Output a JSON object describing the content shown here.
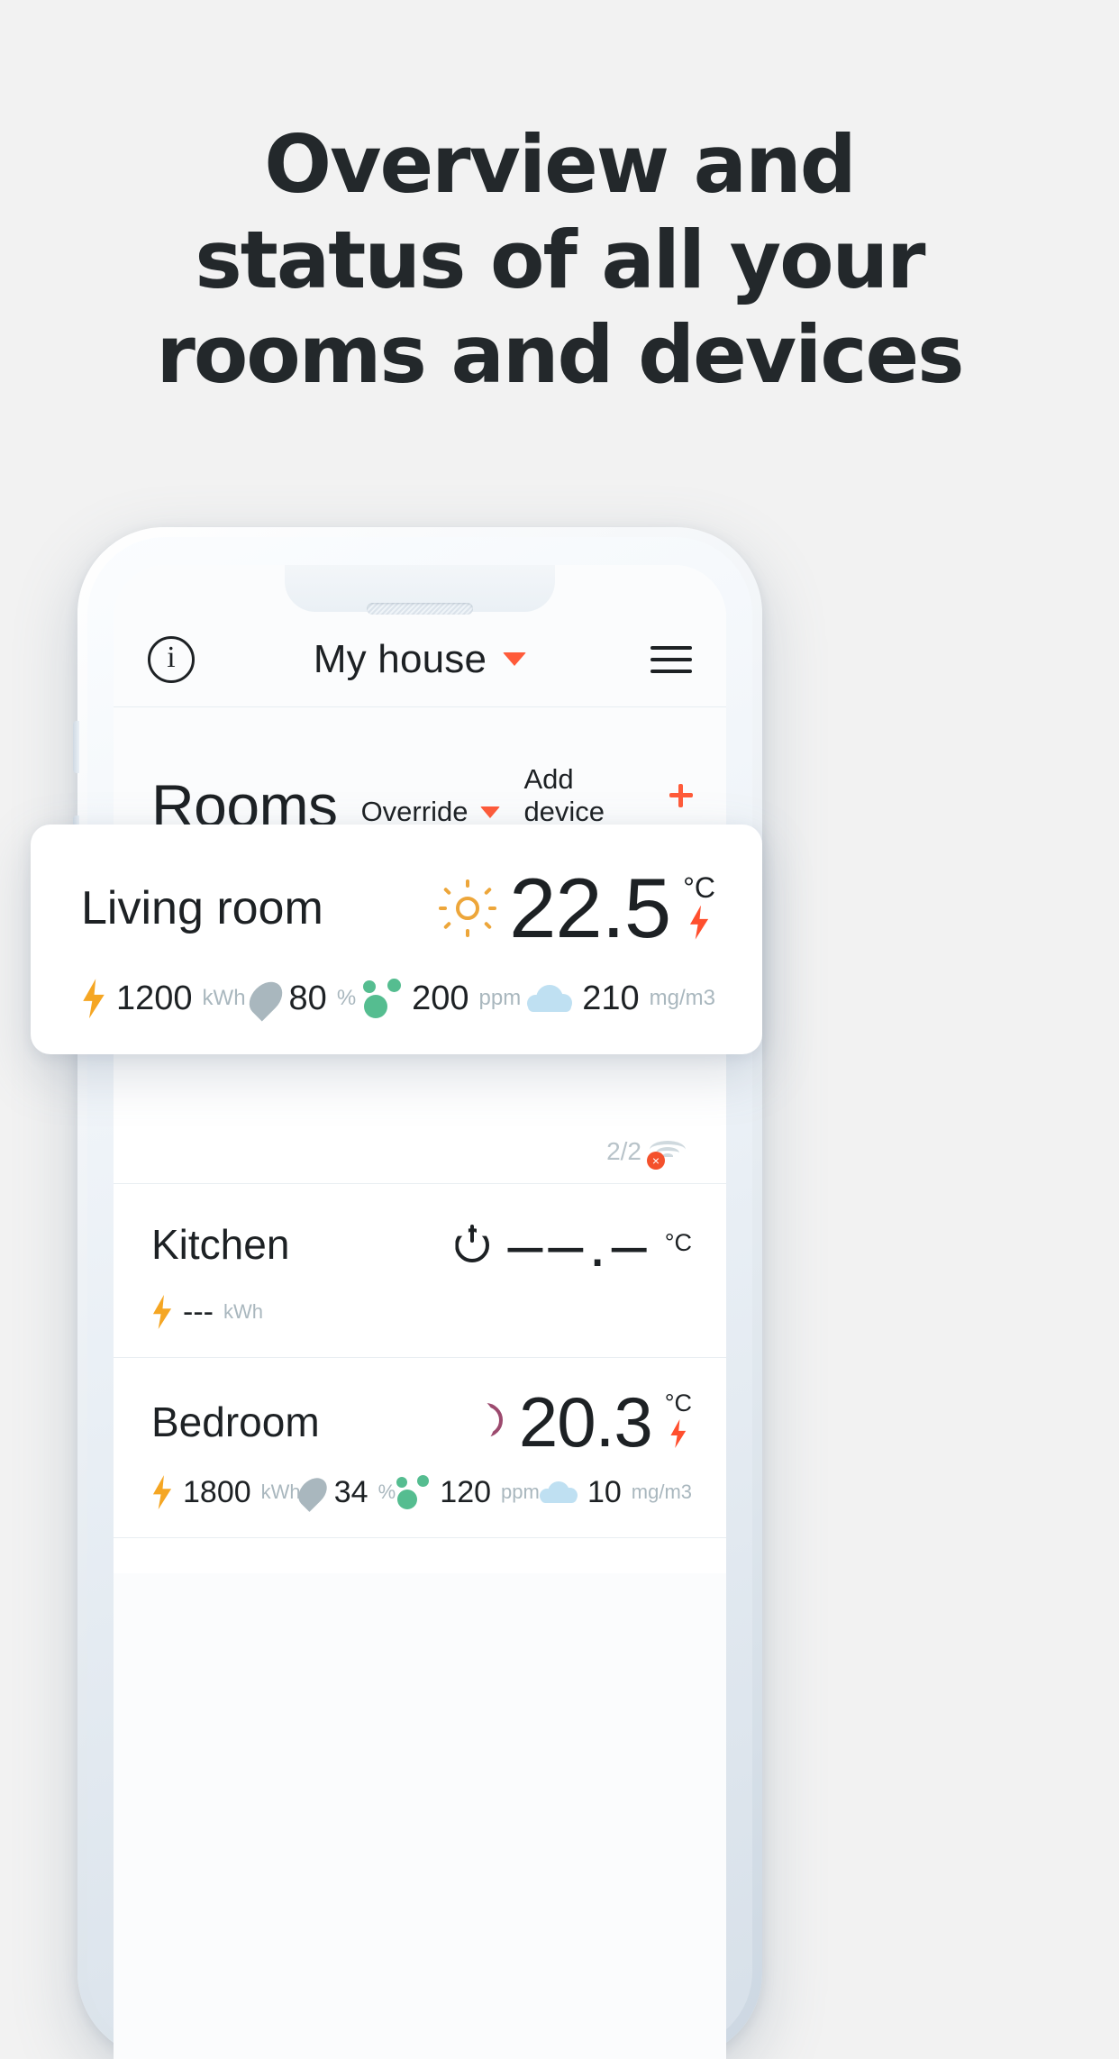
{
  "headline": {
    "line1": "Overview and",
    "line2": "status of all your",
    "line3": "rooms and devices"
  },
  "app": {
    "navbar": {
      "info_icon": "info-icon",
      "title": "My house",
      "chevron_icon": "chevron-down-icon",
      "menu_icon": "hamburger-menu-icon"
    },
    "section": {
      "title": "Rooms",
      "override_label": "Override",
      "override_chevron": "chevron-down-icon",
      "add_device_label": "Add device",
      "add_device_icon": "plus-icon"
    },
    "colors": {
      "accent": "#ff5b3a",
      "energy": "#f5a623",
      "humidity": "#a9b7be",
      "co2": "#55bd90",
      "voc": "#bfe0f2",
      "sun": "#eda63a",
      "moon": "#9c4a6e",
      "text": "#1d2124",
      "muted": "#a9b7be"
    },
    "rooms": [
      {
        "name": "Living room",
        "mode_icon": "sun-icon",
        "temperature": "22.5",
        "temperature_unit": "°C",
        "heating_icon": "lightning-bolt-icon",
        "metrics": [
          {
            "icon": "lightning-bolt-icon",
            "value": "1200",
            "unit": "kWh"
          },
          {
            "icon": "water-drop-icon",
            "value": "80",
            "unit": "%"
          },
          {
            "icon": "co2-molecule-icon",
            "value": "200",
            "unit": "ppm"
          },
          {
            "icon": "cloud-icon",
            "value": "210",
            "unit": "mg/m3"
          }
        ]
      },
      {
        "name": "Kitchen",
        "mode_icon": "power-icon",
        "temperature": "––.–",
        "temperature_unit": "°C",
        "device_count": "2/2",
        "wifi_icon": "wifi-error-icon",
        "metrics": [
          {
            "icon": "lightning-bolt-icon",
            "value": "---",
            "unit": "kWh"
          }
        ]
      },
      {
        "name": "Bedroom",
        "mode_icon": "moon-icon",
        "temperature": "20.3",
        "temperature_unit": "°C",
        "heating_icon": "lightning-bolt-icon",
        "metrics": [
          {
            "icon": "lightning-bolt-icon",
            "value": "1800",
            "unit": "kWh"
          },
          {
            "icon": "water-drop-icon",
            "value": "34",
            "unit": "%"
          },
          {
            "icon": "co2-molecule-icon",
            "value": "120",
            "unit": "ppm"
          },
          {
            "icon": "cloud-icon",
            "value": "10",
            "unit": "mg/m3"
          }
        ]
      }
    ]
  }
}
